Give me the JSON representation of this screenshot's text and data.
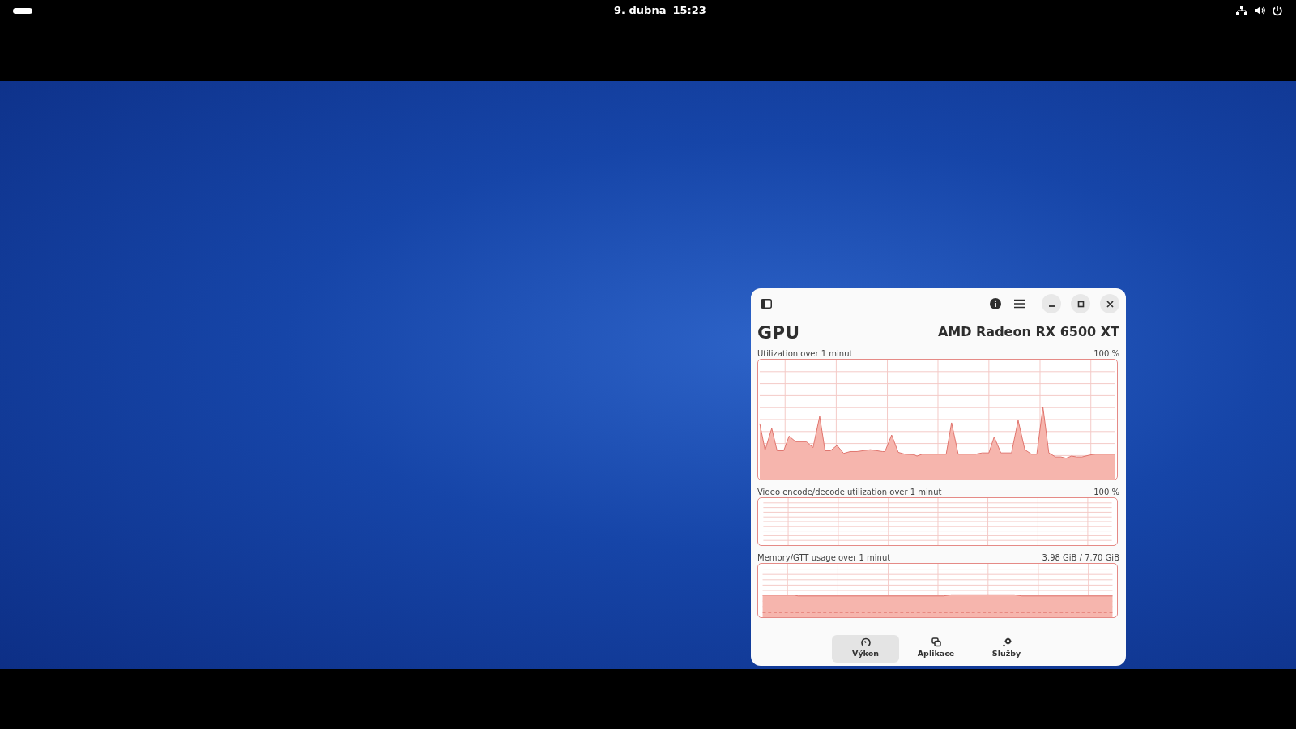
{
  "top_bar": {
    "date": "9. dubna",
    "time": "15:23"
  },
  "window": {
    "title": "GPU",
    "device": "AMD Radeon RX 6500 XT",
    "graphs": [
      {
        "kind": "spikes",
        "label": "Utilization over 1 minut",
        "reading": "100 %"
      },
      {
        "kind": "empty",
        "label": "Video encode/decode utilization over 1 minut",
        "reading": "100 %"
      },
      {
        "kind": "flat",
        "label": "Memory/GTT usage over 1 minut",
        "reading": "3.98 GiB / 7.70 GiB"
      }
    ],
    "tabs": [
      {
        "kind": "gauge",
        "label": "Výkon",
        "selected": true
      },
      {
        "kind": "windows",
        "label": "Aplikace",
        "selected": false
      },
      {
        "kind": "gears",
        "label": "Služby",
        "selected": false
      }
    ]
  }
}
